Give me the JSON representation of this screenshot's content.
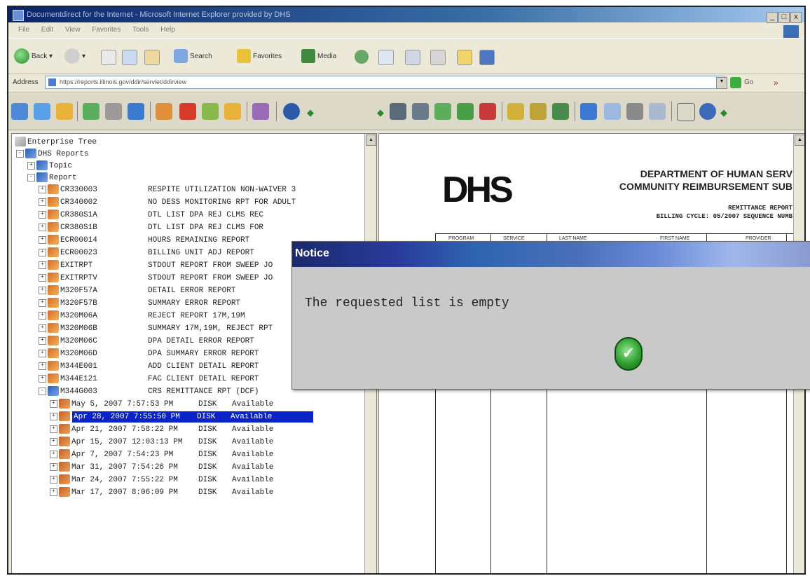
{
  "window": {
    "title": "Documentdirect for the Internet - Microsoft Internet Explorer provided by DHS",
    "buttons": [
      "_",
      "□",
      "x"
    ]
  },
  "menu": [
    "File",
    "Edit",
    "View",
    "Favorites",
    "Tools",
    "Help"
  ],
  "ie_toolbar": {
    "back_label": "Back",
    "search_label": "Search",
    "favorites_label": "Favorites",
    "media_label": "Media"
  },
  "address": {
    "label": "Address",
    "url": "https://reports.illinois.gov/ddir/servlet/ddirview",
    "go_label": "Go",
    "links_label": "»"
  },
  "tree": {
    "root": "Enterprise Tree",
    "reports_root": "DHS Reports",
    "topic": "Topic",
    "report": "Report",
    "items": [
      {
        "code": "CR330003",
        "desc": "RESPITE UTILIZATION NON-WAIVER 3"
      },
      {
        "code": "CR340002",
        "desc": "NO DESS MONITORING RPT FOR ADULT"
      },
      {
        "code": "CR380S1A",
        "desc": "DTL LIST DPA REJ CLMS REC"
      },
      {
        "code": "CR380S1B",
        "desc": "DTL LIST DPA REJ CLMS FOR"
      },
      {
        "code": "ECR00014",
        "desc": "HOURS REMAINING REPORT"
      },
      {
        "code": "ECR00023",
        "desc": "BILLING UNIT ADJ REPORT"
      },
      {
        "code": "EXITRPT",
        "desc": "STDOUT REPORT FROM SWEEP JO"
      },
      {
        "code": "EXITRPTV",
        "desc": "STDOUT REPORT FROM SWEEP JO"
      },
      {
        "code": "M320F57A",
        "desc": "DETAIL ERROR REPORT"
      },
      {
        "code": "M320F57B",
        "desc": "SUMMARY ERROR REPORT"
      },
      {
        "code": "M320M06A",
        "desc": "REJECT REPORT 17M,19M"
      },
      {
        "code": "M320M06B",
        "desc": "SUMMARY 17M,19M, REJECT RPT"
      },
      {
        "code": "M320M06C",
        "desc": "DPA DETAIL ERROR REPORT"
      },
      {
        "code": "M320M06D",
        "desc": "DPA SUMMARY ERROR REPORT"
      },
      {
        "code": "M344E001",
        "desc": "ADD CLIENT DETAIL REPORT"
      },
      {
        "code": "M344E121",
        "desc": "FAC CLIENT DETAIL REPORT"
      },
      {
        "code": "M344G003",
        "desc": "CRS REMITTANCE RPT (DCF)"
      }
    ],
    "versions": [
      {
        "date": "May 5, 2007 7:57:53 PM",
        "loc": "DISK",
        "status": "Available",
        "selected": false
      },
      {
        "date": "Apr 28, 2007 7:55:50 PM",
        "loc": "DISK",
        "status": "Available",
        "selected": true
      },
      {
        "date": "Apr 21, 2007 7:58:22 PM",
        "loc": "DISK",
        "status": "Available",
        "selected": false
      },
      {
        "date": "Apr 15, 2007 12:03:13 PM",
        "loc": "DISK",
        "status": "Available",
        "selected": false
      },
      {
        "date": "Apr 7, 2007 7:54:23 PM",
        "loc": "DISK",
        "status": "Available",
        "selected": false
      },
      {
        "date": "Mar 31, 2007 7:54:26 PM",
        "loc": "DISK",
        "status": "Available",
        "selected": false
      },
      {
        "date": "Mar 24, 2007 7:55:22 PM",
        "loc": "DISK",
        "status": "Available",
        "selected": false
      },
      {
        "date": "Mar 17, 2007 8:06:09 PM",
        "loc": "DISK",
        "status": "Available",
        "selected": false
      }
    ]
  },
  "document": {
    "logo": "DHS",
    "dept_line1": "DEPARTMENT OF HUMAN SERV",
    "dept_line2": "COMMUNITY REIMBURSEMENT SUB",
    "remit_line1": "REMITTANCE REPORT",
    "remit_line2": "BILLING CYCLE: 05/2007 SEQUENCE NUMB",
    "headers": [
      "PROGRAM",
      "SERVICE",
      "LAST NAME",
      "FIRST NAME",
      "PROVIDER"
    ]
  },
  "notice": {
    "title": "Notice",
    "message": "The requested list is empty",
    "ok_symbol": "✓"
  }
}
